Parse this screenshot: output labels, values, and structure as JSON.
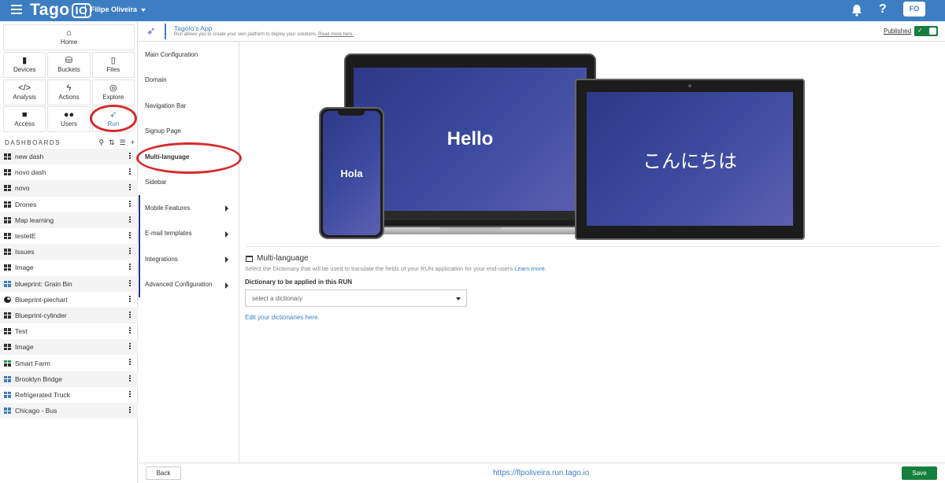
{
  "topbar": {
    "logo_text": "Tago",
    "logo_io": "IO",
    "account_name": "Filipe Oliveira",
    "help_label": "?",
    "avatar_initials": "FO"
  },
  "sidebar": {
    "nav": [
      {
        "label": "Home",
        "icon": "home-icon"
      },
      {
        "label": "Devices",
        "icon": "device-icon"
      },
      {
        "label": "Buckets",
        "icon": "bucket-icon"
      },
      {
        "label": "Files",
        "icon": "file-icon"
      },
      {
        "label": "Analysis",
        "icon": "code-icon"
      },
      {
        "label": "Actions",
        "icon": "bolt-icon"
      },
      {
        "label": "Explore",
        "icon": "compass-icon"
      },
      {
        "label": "Access",
        "icon": "lock-icon"
      },
      {
        "label": "Users",
        "icon": "users-icon"
      },
      {
        "label": "Run",
        "icon": "rocket-icon"
      }
    ],
    "dashboards_heading": "DASHBOARDS",
    "dashboards": [
      {
        "label": "new dash"
      },
      {
        "label": "novo dash"
      },
      {
        "label": "novo"
      },
      {
        "label": "Drones"
      },
      {
        "label": "Map learning"
      },
      {
        "label": "testeIE"
      },
      {
        "label": "Issues"
      },
      {
        "label": "Image"
      },
      {
        "label": "blueprint: Grain Bin"
      },
      {
        "label": "Blueprint-piechart"
      },
      {
        "label": "Blueprint-cylinder"
      },
      {
        "label": "Test"
      },
      {
        "label": "Image"
      },
      {
        "label": "Smart Farm"
      },
      {
        "label": "Brooklyn Bridge"
      },
      {
        "label": "Refrigerated Truck"
      },
      {
        "label": "Chicago - Bus"
      }
    ]
  },
  "app_header": {
    "title": "TagoIo's App",
    "description": "Run allows you to create your own platform to deploy your solutions.",
    "read_more": "Read more here.",
    "published_label": "Published",
    "published": true
  },
  "subnav": {
    "items": [
      {
        "label": "Main Configuration"
      },
      {
        "label": "Domain"
      },
      {
        "label": "Navigation Bar"
      },
      {
        "label": "Signup Page"
      },
      {
        "label": "Multi-language"
      },
      {
        "label": "Sidebar"
      },
      {
        "label": "Mobile Features"
      },
      {
        "label": "E-mail templates"
      },
      {
        "label": "Integrations"
      },
      {
        "label": "Advanced Configuration"
      }
    ],
    "selected": "Multi-language"
  },
  "preview": {
    "laptop_text": "Hello",
    "phone_text": "Hola",
    "tablet_text": "こんにちは"
  },
  "multilanguage": {
    "heading": "Multi-language",
    "description": "Select the Dictionary that will be used to translate the fields of your RUN application for your end-users",
    "learn_more": "Learn more.",
    "dict_label": "Dictionary to be applied in this RUN",
    "dict_placeholder": "select a dictionary",
    "edit_link": "Edit your dictionaries here."
  },
  "footer": {
    "back_label": "Back",
    "url": "https://flpoliveira.run.tago.io",
    "save_label": "Save"
  }
}
